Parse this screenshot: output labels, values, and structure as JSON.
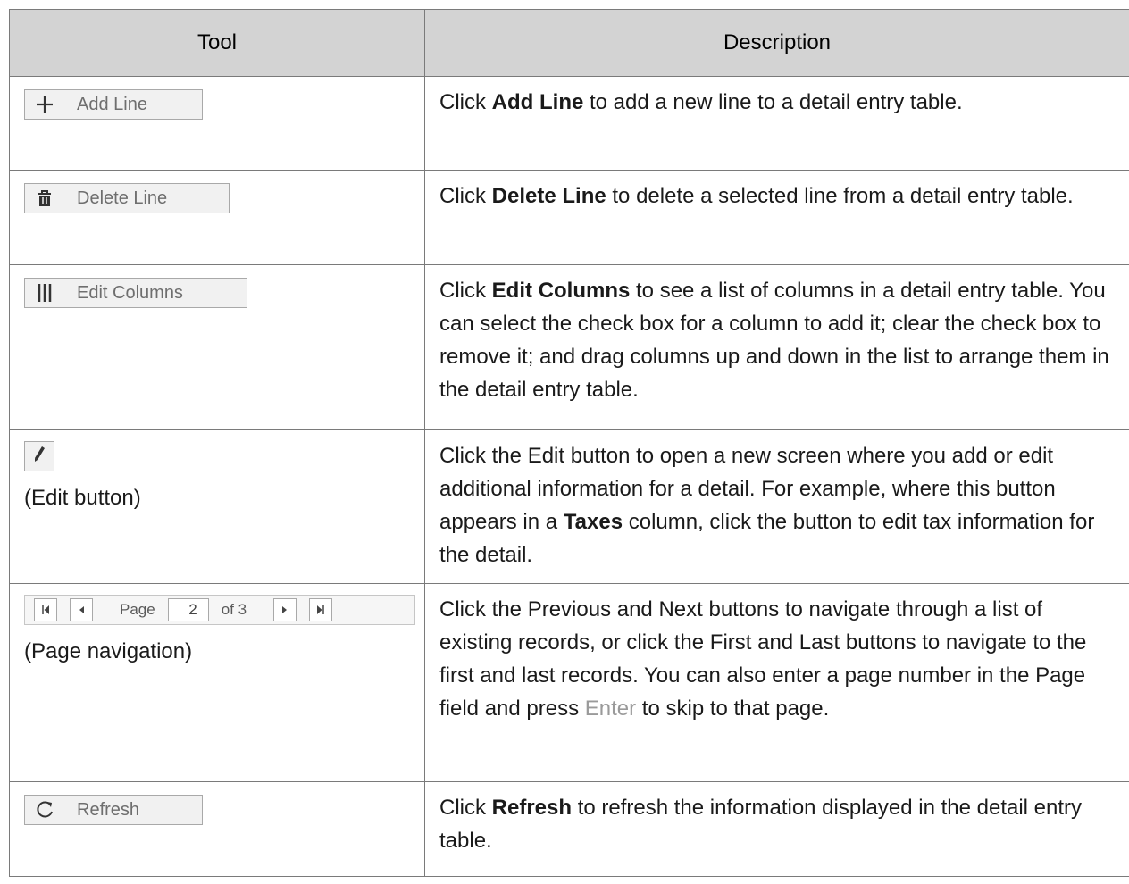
{
  "header": {
    "tool": "Tool",
    "description": "Description"
  },
  "rows": [
    {
      "button_label": "Add Line",
      "icon": "plus-icon",
      "desc": [
        {
          "t": "Click "
        },
        {
          "t": "Add Line",
          "b": true
        },
        {
          "t": " to add a new line to a detail entry table."
        }
      ]
    },
    {
      "button_label": "Delete Line",
      "icon": "trash-icon",
      "desc": [
        {
          "t": "Click "
        },
        {
          "t": "Delete Line",
          "b": true
        },
        {
          "t": " to delete a selected line from a detail entry table."
        }
      ]
    },
    {
      "button_label": "Edit Columns",
      "icon": "columns-icon",
      "desc": [
        {
          "t": "Click "
        },
        {
          "t": "Edit Columns",
          "b": true
        },
        {
          "t": " to see a list of columns in a detail entry table. You can select the check box for a column to add it; clear the check box to remove it; and drag columns up and down in the list to arrange them in the detail entry table."
        }
      ]
    },
    {
      "caption": "(Edit button)",
      "icon": "pencil-icon",
      "desc": [
        {
          "t": "Click the Edit button to open a new screen where you add or edit additional information for a detail. For example, where this button appears in a "
        },
        {
          "t": "Taxes",
          "b": true
        },
        {
          "t": " column, click the button to edit tax information for the detail."
        }
      ]
    },
    {
      "caption": "(Page navigation)",
      "pager": {
        "page_label": "Page",
        "page_value": "2",
        "of_label": "of 3"
      },
      "desc": [
        {
          "t": "Click the Previous and Next buttons to navigate through a list of existing records, or click the First and Last buttons to navigate to the first and last records. You can also enter a page number in the Page field and press "
        },
        {
          "t": "Enter",
          "k": true
        },
        {
          "t": " to skip to that page."
        }
      ]
    },
    {
      "button_label": "Refresh",
      "icon": "refresh-icon",
      "desc": [
        {
          "t": "Click "
        },
        {
          "t": "Refresh",
          "b": true
        },
        {
          "t": " to refresh the information displayed in the detail entry table."
        }
      ]
    }
  ]
}
